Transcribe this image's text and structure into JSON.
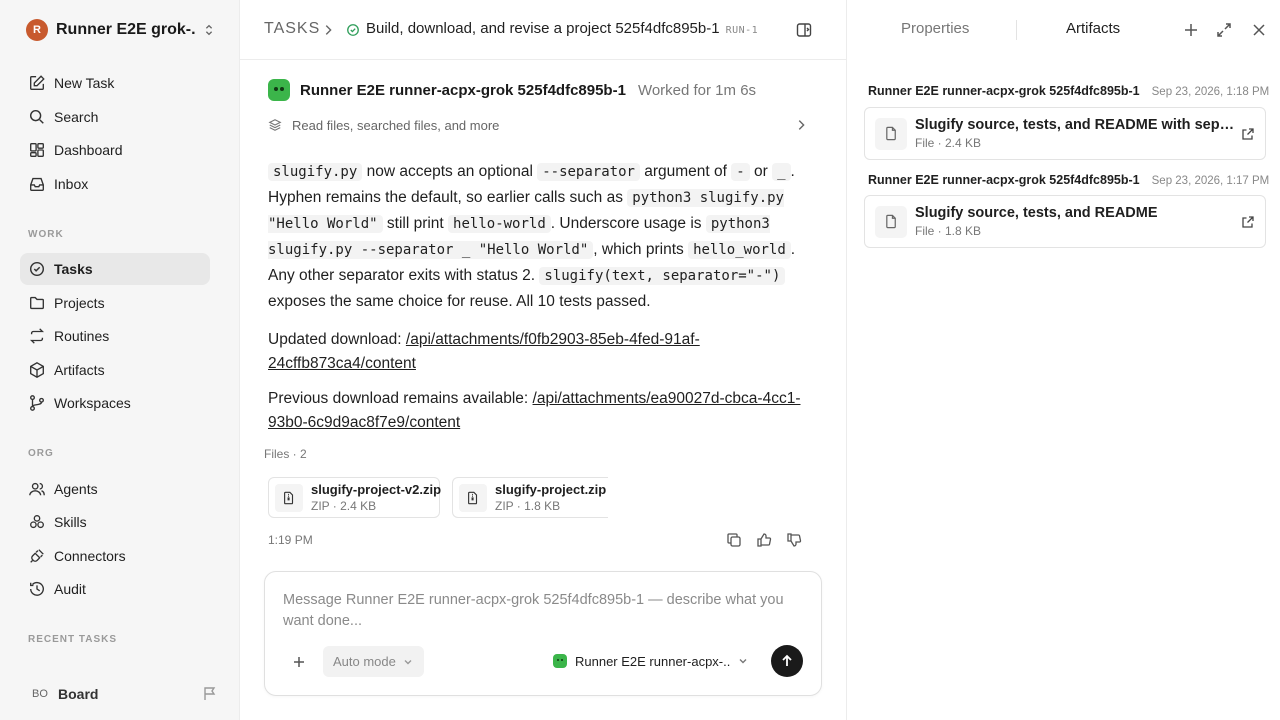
{
  "workspace": {
    "name": "Runner E2E grok-...",
    "logo_text": "R"
  },
  "sidebar": {
    "nav": [
      {
        "label": "New Task",
        "icon": "pencil-square-icon"
      },
      {
        "label": "Search",
        "icon": "search-icon"
      },
      {
        "label": "Dashboard",
        "icon": "dashboard-icon"
      },
      {
        "label": "Inbox",
        "icon": "inbox-icon"
      }
    ],
    "work_label": "WORK",
    "work": [
      {
        "label": "Tasks",
        "icon": "check-circle-icon",
        "active": true
      },
      {
        "label": "Projects",
        "icon": "folder-icon"
      },
      {
        "label": "Routines",
        "icon": "repeat-icon"
      },
      {
        "label": "Artifacts",
        "icon": "cube-icon"
      },
      {
        "label": "Workspaces",
        "icon": "git-branch-icon"
      }
    ],
    "org_label": "ORG",
    "org": [
      {
        "label": "Agents",
        "icon": "users-icon"
      },
      {
        "label": "Skills",
        "icon": "skills-icon"
      },
      {
        "label": "Connectors",
        "icon": "plug-icon"
      },
      {
        "label": "Audit",
        "icon": "history-icon"
      }
    ],
    "recent_label": "RECENT TASKS",
    "board": {
      "avatar": "BO",
      "name": "Board"
    }
  },
  "header": {
    "crumb_root": "TASKS",
    "task_title": "Build, download, and revise a project 525f4dfc895b-1",
    "run_id": "RUN-1"
  },
  "message": {
    "agent_name": "Runner E2E runner-acpx-grok 525f4dfc895b-1",
    "worked_for": "Worked for 1m 6s",
    "tools_summary": "Read files, searched files, and more",
    "body": {
      "p1": [
        "slugify.py",
        " now accepts an optional ",
        "--separator",
        " argument of ",
        "-",
        " or ",
        "_",
        ". Hyphen remains the default, so earlier calls such as ",
        "python3 slugify.py \"Hello World\"",
        " still print ",
        "hello-world",
        ". Underscore usage is ",
        "python3 slugify.py --separator _ \"Hello World\"",
        ", which prints ",
        "hello_world",
        ". Any other separator exits with status 2. ",
        "slugify(text, separator=\"-\")",
        " exposes the same choice for reuse. All 10 tests passed."
      ]
    },
    "updated_label": "Updated download: ",
    "updated_link": "/api/attachments/f0fb2903-85eb-4fed-91af-24cffb873ca4/content",
    "previous_label": "Previous download remains available: ",
    "previous_link": "/api/attachments/ea90027d-cbca-4cc1-93b0-6c9d9ac8f7e9/content",
    "files_label": "Files · 2",
    "files": [
      {
        "name": "slugify-project-v2.zip",
        "meta": "ZIP · 2.4 KB"
      },
      {
        "name": "slugify-project.zip",
        "meta": "ZIP · 1.8 KB"
      }
    ],
    "timestamp": "1:19 PM"
  },
  "composer": {
    "placeholder": "Message Runner E2E runner-acpx-grok 525f4dfc895b-1 — describe what you want done...",
    "mode": "Auto mode",
    "agent": "Runner E2E runner-acpx-..."
  },
  "right_panel": {
    "tabs": {
      "properties": "Properties",
      "artifacts": "Artifacts"
    },
    "artifacts": [
      {
        "author": "Runner E2E runner-acpx-grok 525f4dfc895b-1",
        "date": "Sep 23, 2026, 1:18 PM",
        "title": "Slugify source, tests, and README with separ...",
        "meta": "File · 2.4 KB"
      },
      {
        "author": "Runner E2E runner-acpx-grok 525f4dfc895b-1",
        "date": "Sep 23, 2026, 1:17 PM",
        "title": "Slugify source, tests, and README",
        "meta": "File · 1.8 KB"
      }
    ]
  },
  "colors": {
    "accent_green": "#2f9e5a",
    "agent_green": "#3bb54a",
    "send_button": "#1a1a1a",
    "sidebar_bg": "#f6f6f6"
  }
}
